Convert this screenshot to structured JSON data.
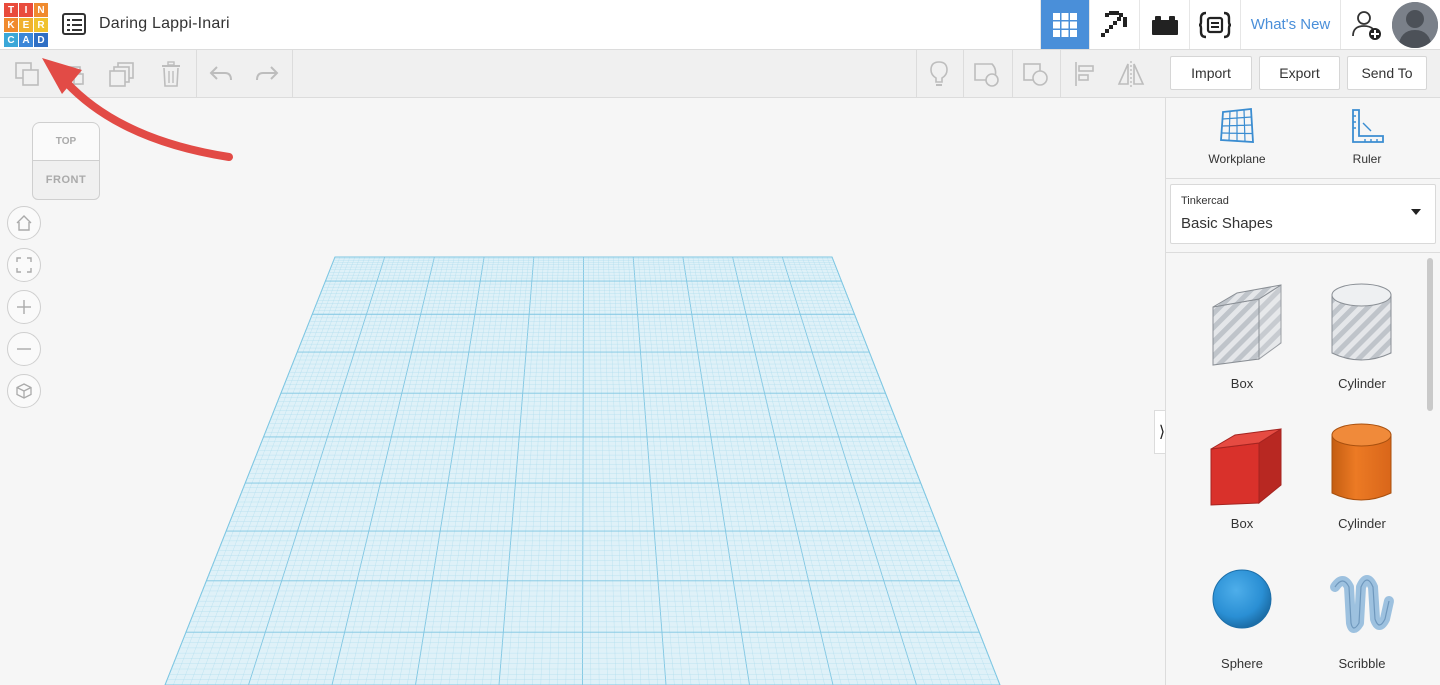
{
  "header": {
    "logo_letters": [
      "T",
      "I",
      "N",
      "K",
      "E",
      "R",
      "C",
      "A",
      "D"
    ],
    "logo_colors": [
      "#e94b3c",
      "#e94b3c",
      "#f08a2e",
      "#f08a2e",
      "#f0b12e",
      "#f0c22e",
      "#3aa7d8",
      "#3a86d8",
      "#2f6fc4"
    ],
    "design_title": "Daring Lappi-Inari",
    "whats_new_label": "What's New",
    "nav_icons": [
      "grid-view-icon",
      "pickaxe-icon",
      "bricks-icon",
      "codeblocks-icon"
    ],
    "accent": "#4a8fd9"
  },
  "toolbar": {
    "tools": [
      "copy-icon",
      "paste-icon",
      "duplicate-icon",
      "delete-icon",
      "undo-icon",
      "redo-icon"
    ],
    "right_tools": [
      "note-icon",
      "hole-shape-icon",
      "group-icon",
      "align-icon",
      "mirror-icon"
    ],
    "import_label": "Import",
    "export_label": "Export",
    "send_to_label": "Send To"
  },
  "viewcube": {
    "top_label": "TOP",
    "front_label": "FRONT"
  },
  "view_controls": [
    "home-view-icon",
    "fit-view-icon",
    "zoom-in-icon",
    "zoom-out-icon",
    "perspective-icon"
  ],
  "panel": {
    "workplane_label": "Workplane",
    "ruler_label": "Ruler",
    "library_source": "Tinkercad",
    "library_name": "Basic Shapes",
    "shapes": [
      {
        "label": "Box",
        "kind": "hole-box"
      },
      {
        "label": "Cylinder",
        "kind": "hole-cylinder"
      },
      {
        "label": "Box",
        "kind": "box",
        "color": "#d9312b"
      },
      {
        "label": "Cylinder",
        "kind": "cylinder",
        "color": "#e8731f"
      },
      {
        "label": "Sphere",
        "kind": "sphere",
        "color": "#2a8fd4"
      },
      {
        "label": "Scribble",
        "kind": "scribble",
        "color": "#8fb7d9"
      }
    ]
  },
  "annotation_color": "#e24b46"
}
